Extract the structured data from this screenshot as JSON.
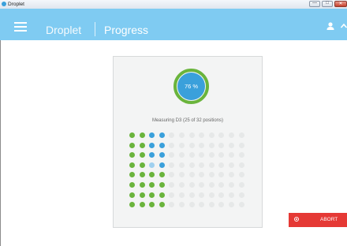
{
  "window": {
    "title": "Droplet",
    "controls": {
      "minimize_glyph": "—",
      "maximize_glyph": "□",
      "close_glyph": "✕"
    }
  },
  "appbar": {
    "brand": "Droplet",
    "page_title": "Progress",
    "color": "#7fcbf2",
    "icons": [
      "menu-icon",
      "user-icon",
      "chevron-up-icon"
    ]
  },
  "progress": {
    "percent_label": "76 %",
    "percent_value": 76,
    "status": "Measuring D3 (25 of 32 positions)",
    "completed_positions": 25,
    "total_positions": 32,
    "ring_color": "#3aa0db",
    "ring_track_color": "#6ab43c"
  },
  "wells": {
    "rows": 8,
    "columns": 12,
    "states_comment": "done=green, measuring=blue, current=light-blue, pending=faded",
    "grid": [
      [
        "done",
        "done",
        "measuring",
        "measuring",
        "pending",
        "pending",
        "pending",
        "pending",
        "pending",
        "pending",
        "pending",
        "pending"
      ],
      [
        "done",
        "done",
        "measuring",
        "measuring",
        "pending",
        "pending",
        "pending",
        "pending",
        "pending",
        "pending",
        "pending",
        "pending"
      ],
      [
        "done",
        "done",
        "measuring",
        "measuring",
        "pending",
        "pending",
        "pending",
        "pending",
        "pending",
        "pending",
        "pending",
        "pending"
      ],
      [
        "done",
        "done",
        "current",
        "measuring",
        "pending",
        "pending",
        "pending",
        "pending",
        "pending",
        "pending",
        "pending",
        "pending"
      ],
      [
        "done",
        "done",
        "done",
        "done",
        "pending",
        "pending",
        "pending",
        "pending",
        "pending",
        "pending",
        "pending",
        "pending"
      ],
      [
        "done",
        "done",
        "done",
        "done",
        "pending",
        "pending",
        "pending",
        "pending",
        "pending",
        "pending",
        "pending",
        "pending"
      ],
      [
        "done",
        "done",
        "done",
        "done",
        "pending",
        "pending",
        "pending",
        "pending",
        "pending",
        "pending",
        "pending",
        "pending"
      ],
      [
        "done",
        "done",
        "done",
        "done",
        "pending",
        "pending",
        "pending",
        "pending",
        "pending",
        "pending",
        "pending",
        "pending"
      ]
    ],
    "colors": {
      "done": "#6ab43c",
      "measuring": "#3aa0db",
      "current": "#9fd0ef",
      "pending": "#e6e8e8"
    }
  },
  "actions": {
    "abort_label": "ABORT",
    "abort_color": "#e53935",
    "abort_icon": "stop-circle-icon"
  }
}
